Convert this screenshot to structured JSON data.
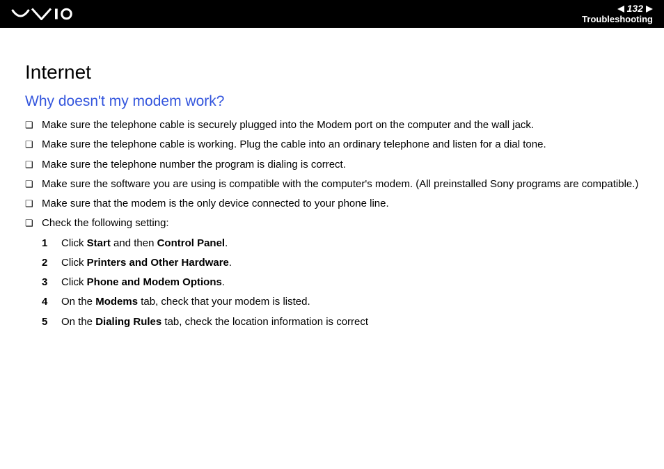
{
  "header": {
    "page_number": "132",
    "section": "Troubleshooting"
  },
  "content": {
    "title": "Internet",
    "subtitle": "Why doesn't my modem work?",
    "bullets": [
      "Make sure the telephone cable is securely plugged into the Modem port on the computer and the wall jack.",
      "Make sure the telephone cable is working. Plug the cable into an ordinary telephone and listen for a dial tone.",
      "Make sure the telephone number the program is dialing is correct.",
      "Make sure the software you are using is compatible with the computer's modem. (All preinstalled Sony programs are compatible.)",
      "Make sure that the modem is the only device connected to your phone line.",
      "Check the following setting:"
    ],
    "steps": [
      {
        "pre": "Click ",
        "bold1": "Start",
        "mid": " and then ",
        "bold2": "Control Panel",
        "post": "."
      },
      {
        "pre": "Click ",
        "bold1": "Printers and Other Hardware",
        "mid": "",
        "bold2": "",
        "post": "."
      },
      {
        "pre": "Click ",
        "bold1": "Phone and Modem Options",
        "mid": "",
        "bold2": "",
        "post": "."
      },
      {
        "pre": "On the ",
        "bold1": "Modems",
        "mid": " tab, check that your modem is listed.",
        "bold2": "",
        "post": ""
      },
      {
        "pre": "On the ",
        "bold1": "Dialing Rules",
        "mid": " tab, check the location information is correct",
        "bold2": "",
        "post": ""
      }
    ]
  }
}
